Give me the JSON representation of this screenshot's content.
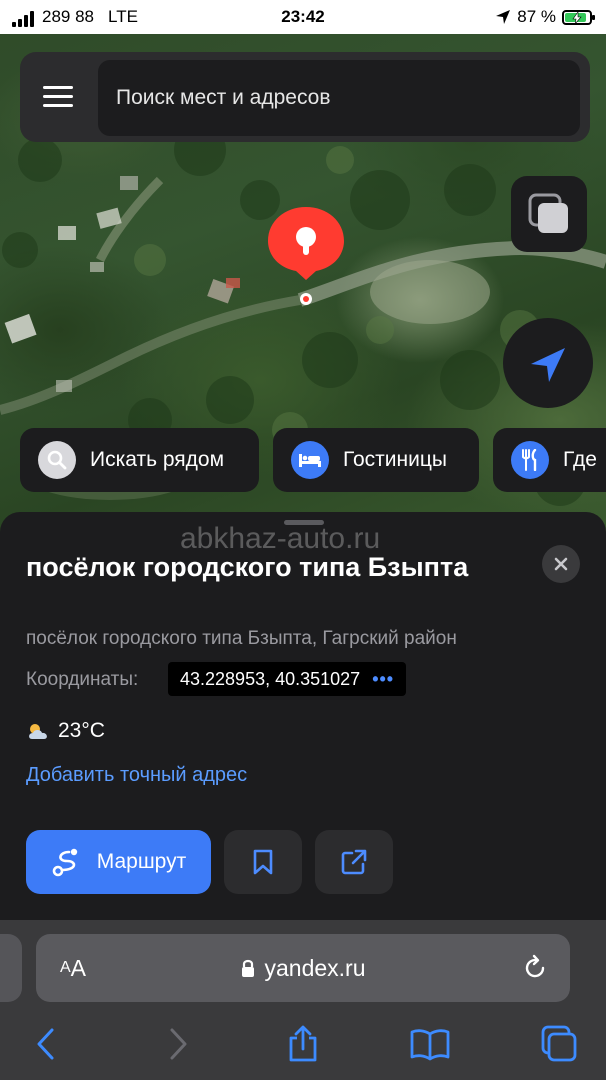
{
  "status_bar": {
    "carrier": "289 88",
    "network": "LTE",
    "time": "23:42",
    "battery_percent": "87 %",
    "battery_level": 0.87
  },
  "search": {
    "placeholder": "Поиск мест и адресов"
  },
  "map": {
    "pin_color": "#ff3b30"
  },
  "chips": [
    {
      "label": "Искать рядом",
      "icon": "search-icon"
    },
    {
      "label": "Гостиницы",
      "icon": "bed-icon"
    },
    {
      "label": "Где",
      "icon": "fork-knife-icon"
    }
  ],
  "place": {
    "watermark": "abkhaz-auto.ru",
    "title": "посёлок городского типа Бзыпта",
    "subtitle": "посёлок городского типа Бзыпта, Гагрский район",
    "coords_label": "Координаты:",
    "coords": "43.228953, 40.351027",
    "coords_more": "•••",
    "temperature": "23°C",
    "add_address": "Добавить точный адрес",
    "route_label": "Маршрут"
  },
  "browser": {
    "reader_label_small": "A",
    "reader_label_big": "A",
    "url": "yandex.ru"
  },
  "colors": {
    "accent": "#3d7bf7",
    "link": "#5b9cff",
    "sheet": "#1c1c1e"
  }
}
